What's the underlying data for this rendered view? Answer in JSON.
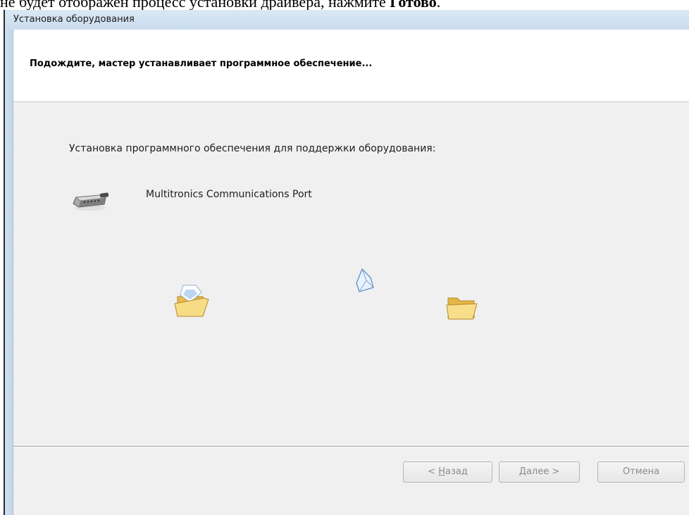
{
  "document": {
    "caption_prefix": "не будет отображен процесс установки драйвера, нажмите ",
    "caption_bold": "Готово",
    "caption_suffix": "."
  },
  "window": {
    "title": "Установка оборудования"
  },
  "header": {
    "title": "Подождите, мастер устанавливает программное обеспечение..."
  },
  "content": {
    "install_label": "Установка программного обеспечения для поддержки оборудования:",
    "device_name": "Multitronics Communications Port",
    "device_icon": "serial-port-device-icon",
    "animation": {
      "source_icon": "folder-open-icon",
      "moving_icon": "flying-paper-icon",
      "target_icon": "folder-icon"
    }
  },
  "buttons": {
    "back": {
      "prefix": "< ",
      "mnemonic": "Н",
      "rest": "азад"
    },
    "next": {
      "mnemonic": "Д",
      "rest": "алее >"
    },
    "cancel": {
      "label": "Отмена"
    },
    "state": "disabled"
  },
  "colors": {
    "title_bar": "#c9dcef",
    "header_bg": "#ffffff",
    "body_bg": "#f0f0f0",
    "disabled_text": "#8c8c8c",
    "folder_yellow": "#f5d46a"
  }
}
